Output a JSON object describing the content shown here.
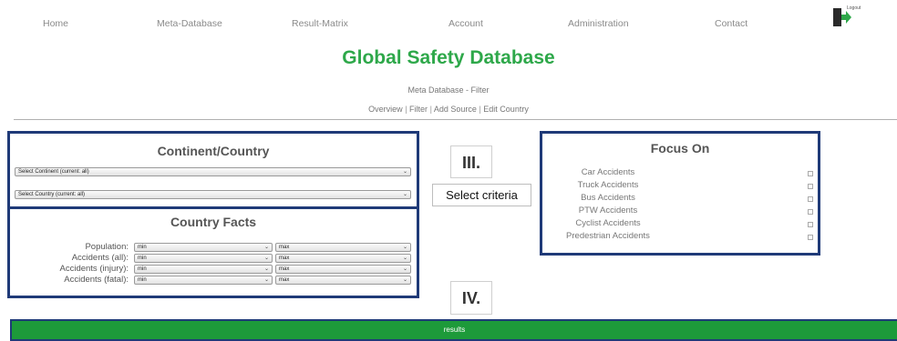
{
  "nav": {
    "items": [
      "Home",
      "Meta-Database",
      "Result-Matrix",
      "Account",
      "Administration",
      "Contact"
    ],
    "logout_label": "Logout"
  },
  "title": "Global Safety Database",
  "subtitle": "Meta Database - Filter",
  "subnav": [
    "Overview",
    "Filter",
    "Add Source",
    "Edit Country"
  ],
  "continent_panel": {
    "title": "Continent/Country",
    "continent_select": "Select Continent (current: all)",
    "country_select": "Select Country (current: all)"
  },
  "facts_panel": {
    "title": "Country Facts",
    "rows": [
      {
        "label": "Population:",
        "min": "min",
        "max": "max"
      },
      {
        "label": "Accidents (all):",
        "min": "min",
        "max": "max"
      },
      {
        "label": "Accidents (injury):",
        "min": "min",
        "max": "max"
      },
      {
        "label": "Accidents (fatal):",
        "min": "min",
        "max": "max"
      }
    ]
  },
  "steps": {
    "three": "III.",
    "four": "IV."
  },
  "select_criteria_label": "Select criteria",
  "focus_panel": {
    "title": "Focus On",
    "items": [
      "Car Accidents",
      "Truck Accidents",
      "Bus Accidents",
      "PTW Accidents",
      "Cyclist Accidents",
      "Predestrian Accidents"
    ]
  },
  "results_label": "results",
  "colors": {
    "title_green": "#2ea84a",
    "panel_border": "#1f3a78",
    "results_green": "#1d9a3a"
  }
}
